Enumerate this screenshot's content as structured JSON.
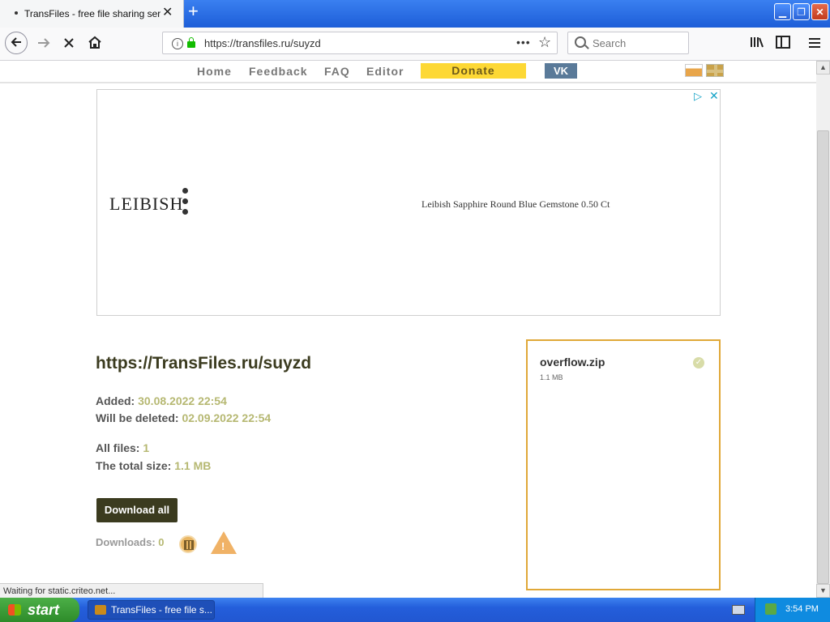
{
  "browser": {
    "tab_title": "TransFiles - free file sharing service",
    "tab_close": "✕",
    "new_tab": "+",
    "url": "https://transfiles.ru/suyzd",
    "search_placeholder": "Search",
    "url_more": "•••",
    "win_min": "▁",
    "win_max": "❐",
    "win_close": "✕"
  },
  "site_nav": {
    "home": "Home",
    "feedback": "Feedback",
    "faq": "FAQ",
    "editor": "Editor",
    "donate": "Donate",
    "vk": "VK"
  },
  "ad": {
    "brand": "LEIBISH",
    "text": "Leibish Sapphire Round Blue Gemstone 0.50 Ct"
  },
  "file_page": {
    "link": "https://TransFiles.ru/suyzd",
    "added_label": "Added:",
    "added_value": "30.08.2022 22:54",
    "deleted_label": "Will be deleted:",
    "deleted_value": "02.09.2022 22:54",
    "all_files_label": "All files:",
    "all_files_value": "1",
    "total_size_label": "The total size:",
    "total_size_value": "1.1 MB",
    "download_all": "Download all",
    "downloads_label": "Downloads:",
    "downloads_value": "0",
    "warn_mark": "!"
  },
  "file": {
    "name": "overflow.zip",
    "size": "1.1 MB",
    "check": "✓"
  },
  "status_text": "Waiting for static.criteo.net...",
  "taskbar": {
    "start": "start",
    "task": "TransFiles - free file s...",
    "clock": "3:54 PM"
  },
  "colors": {
    "accent_dark": "#3b3b1f",
    "value_olive": "#b6b872",
    "donate_yellow": "#fdd835",
    "file_border": "#e0a838"
  }
}
